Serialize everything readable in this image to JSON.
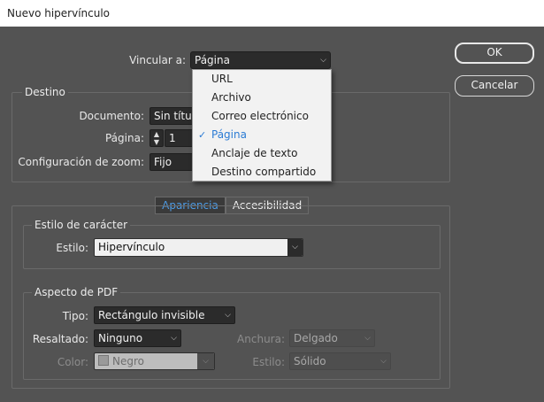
{
  "window": {
    "title": "Nuevo hipervínculo"
  },
  "link_to": {
    "label": "Vincular a:",
    "value": "Página"
  },
  "dropdown": {
    "items": [
      "URL",
      "Archivo",
      "Correo electrónico",
      "Página",
      "Anclaje de texto",
      "Destino compartido"
    ],
    "selected_index": 3
  },
  "buttons": {
    "ok": "OK",
    "cancel": "Cancelar"
  },
  "destino": {
    "legend": "Destino",
    "documento": {
      "label": "Documento:",
      "value": "Sin títul"
    },
    "pagina": {
      "label": "Página:",
      "value": "1"
    },
    "zoom": {
      "label": "Configuración de zoom:",
      "value": "Fijo"
    }
  },
  "tabs": {
    "apariencia": "Apariencia",
    "accesibilidad": "Accesibilidad"
  },
  "estilo_caracter": {
    "legend": "Estilo de carácter",
    "label": "Estilo:",
    "value": "Hipervínculo"
  },
  "aspecto_pdf": {
    "legend": "Aspecto de PDF",
    "tipo": {
      "label": "Tipo:",
      "value": "Rectángulo invisible"
    },
    "resaltado": {
      "label": "Resaltado:",
      "value": "Ninguno"
    },
    "anchura": {
      "label": "Anchura:",
      "value": "Delgado"
    },
    "color": {
      "label": "Color:",
      "value": "Negro",
      "swatch": "#9a9a9a"
    },
    "estilo": {
      "label": "Estilo:",
      "value": "Sólido"
    }
  },
  "colors": {
    "background": "#535353",
    "accent": "#2b7bd4",
    "tab_active_text": "#4d9ce6"
  }
}
